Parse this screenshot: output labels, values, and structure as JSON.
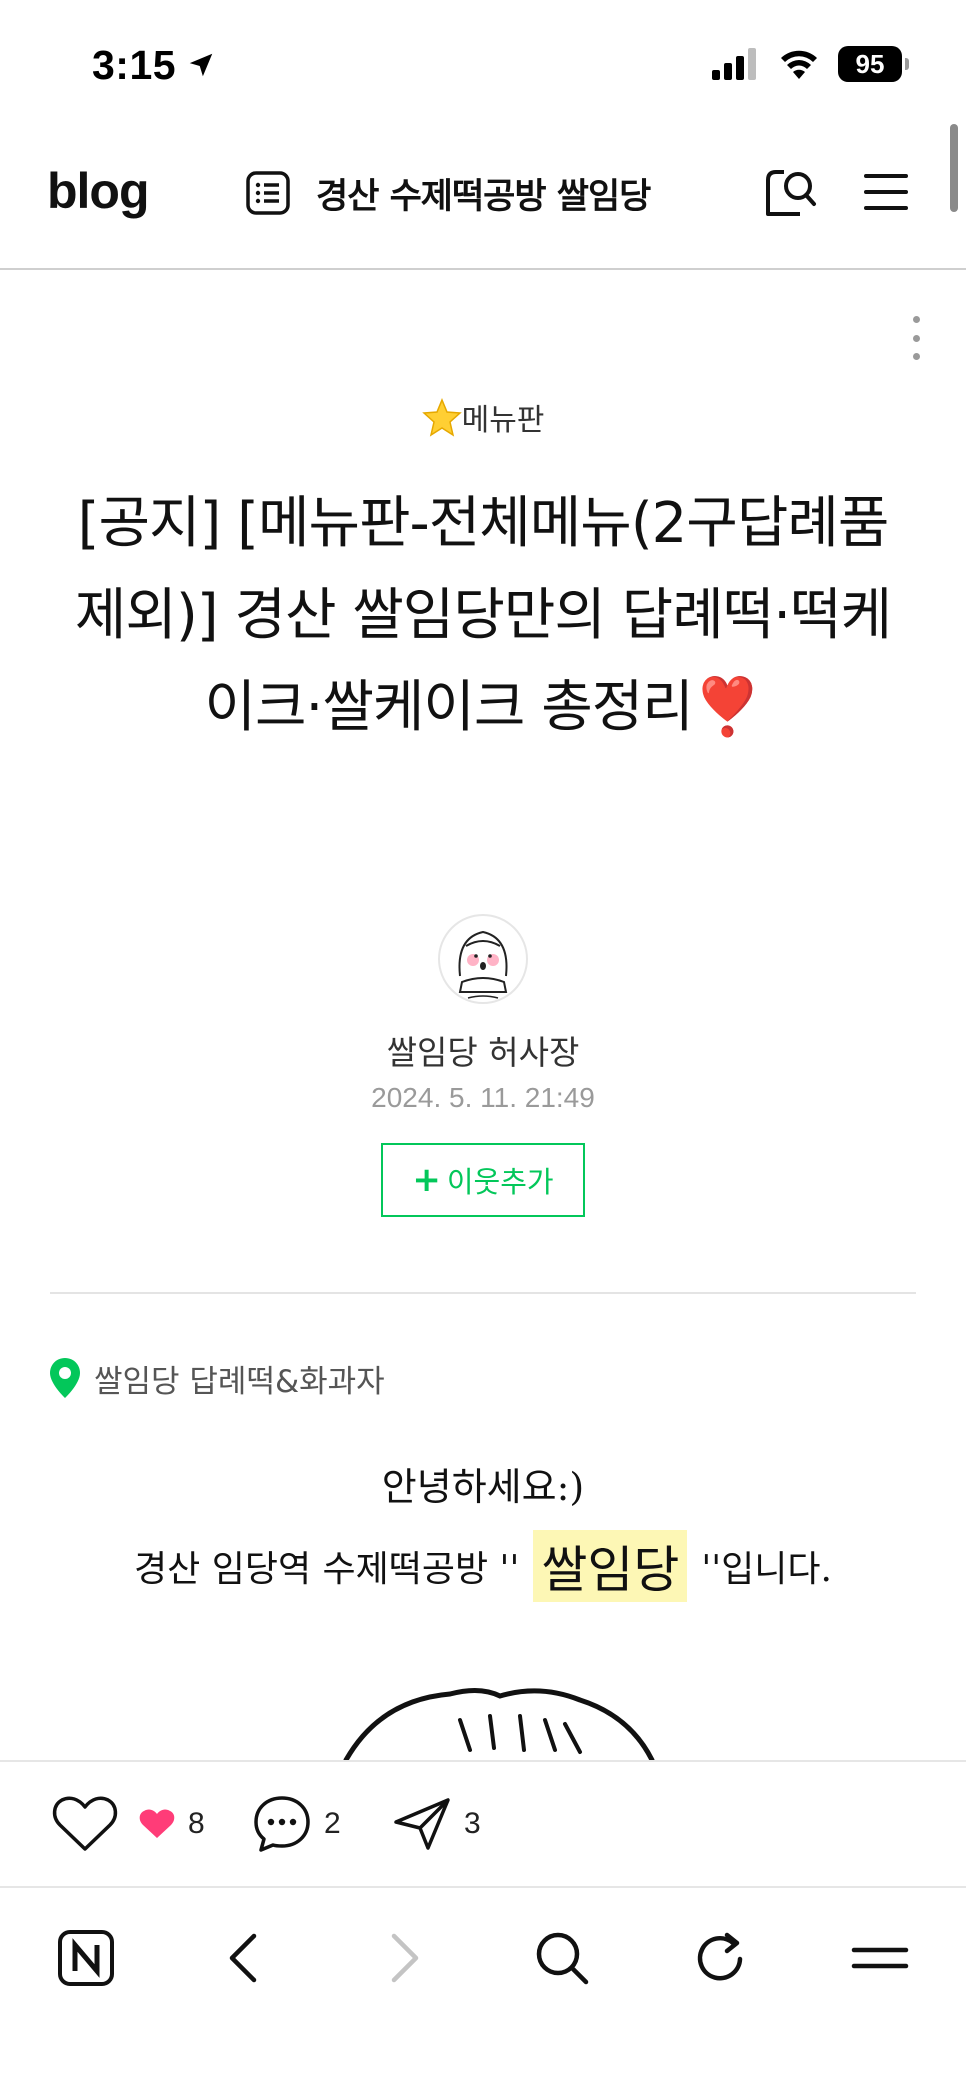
{
  "status_bar": {
    "time": "3:15",
    "battery": "95"
  },
  "header": {
    "logo": "blog",
    "blog_title": "경산 수제떡공방 쌀임당"
  },
  "post": {
    "category": "메뉴판",
    "title": "[공지] [메뉴판-전체메뉴(2구답례품 제외)] 경산 쌀임당만의 답례떡·떡케이크·쌀케이크 총정리",
    "title_mark": "❣️",
    "author": "쌀임당 허사장",
    "date": "2024. 5. 11. 21:49",
    "follow_label": "이웃추가"
  },
  "body": {
    "place": "쌀임당 답례떡&화과자",
    "greeting": "안녕하세요:)",
    "intro_prefix": "경산 임당역 수제떡공방 ''",
    "intro_highlight": "쌀임당",
    "intro_suffix": "''입니다."
  },
  "actions": {
    "like_count": "8",
    "comment_count": "2",
    "share_count": "3"
  },
  "colors": {
    "accent_green": "#03c75a",
    "heart_pink": "#ff3c78",
    "highlight_yellow": "#fdf7b5"
  }
}
